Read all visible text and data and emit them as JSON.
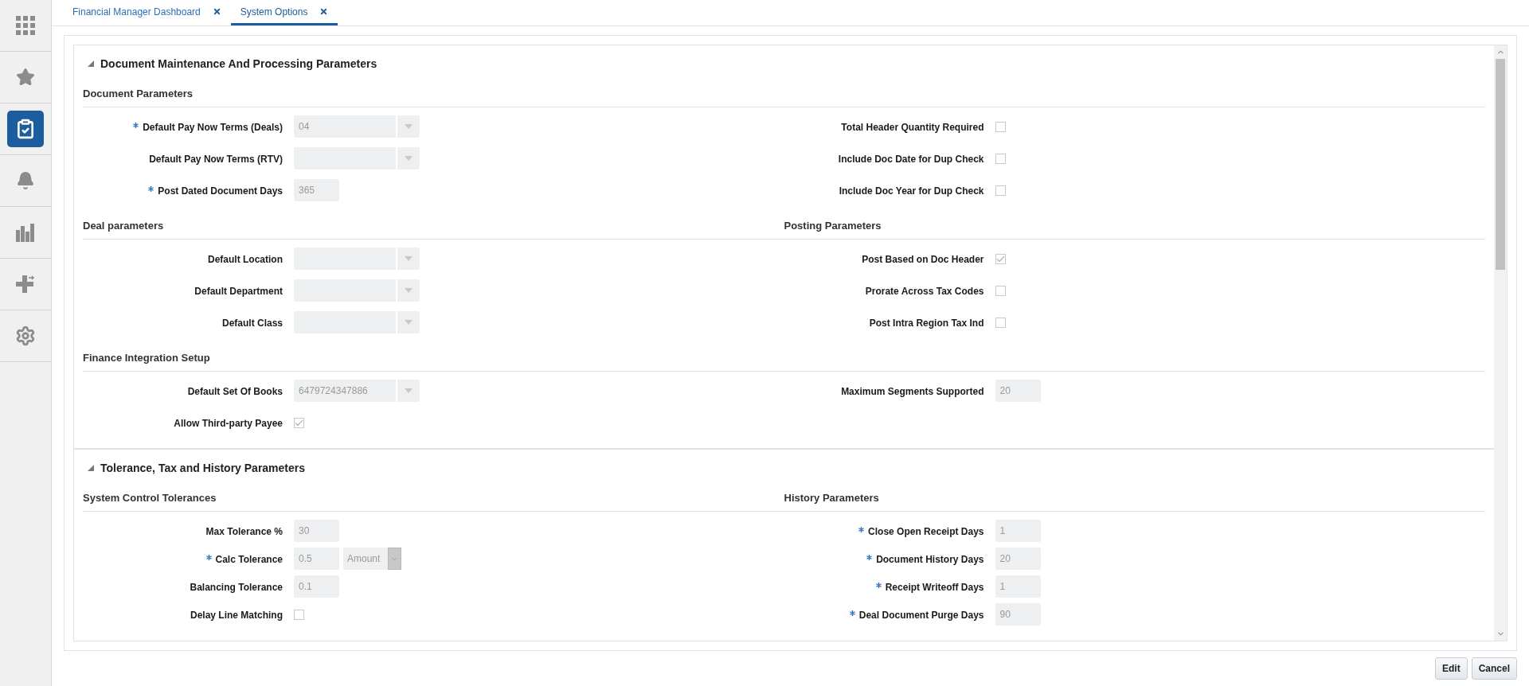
{
  "sidebar": {
    "items": [
      {
        "kind": "apps",
        "selected": false
      },
      {
        "kind": "star",
        "selected": false
      },
      {
        "kind": "tasks",
        "selected": true
      },
      {
        "kind": "bell",
        "selected": false
      },
      {
        "kind": "chart",
        "selected": false
      },
      {
        "kind": "plus",
        "selected": false
      },
      {
        "kind": "gear",
        "selected": false
      }
    ]
  },
  "tabs": [
    {
      "label": "Financial Manager Dashboard",
      "selected": false
    },
    {
      "label": "System Options",
      "selected": true
    }
  ],
  "sections": [
    {
      "title": "Document Maintenance And Processing Parameters",
      "expanded": true,
      "blocks": [
        {
          "left": {
            "heading": "Document Parameters",
            "fields": [
              {
                "kind": "select",
                "label": "Default Pay Now Terms (Deals)",
                "required": true,
                "value": "04"
              },
              {
                "kind": "select",
                "label": "Default Pay Now Terms (RTV)",
                "required": false
              },
              {
                "kind": "text",
                "label": "Post Dated Document Days",
                "required": true,
                "value": "365"
              }
            ]
          },
          "right": {
            "fields": [
              {
                "kind": "checkbox",
                "label": "Total Header Quantity Required",
                "required": false,
                "checked": false
              },
              {
                "kind": "checkbox",
                "label": "Include Doc Date for Dup Check",
                "required": false,
                "checked": false
              },
              {
                "kind": "checkbox",
                "label": "Include Doc Year for Dup Check",
                "required": false,
                "checked": false
              }
            ]
          }
        },
        {
          "left": {
            "heading": "Deal parameters",
            "fields": [
              {
                "kind": "select",
                "label": "Default Location",
                "required": false
              },
              {
                "kind": "select",
                "label": "Default Department",
                "required": false
              },
              {
                "kind": "select",
                "label": "Default Class",
                "required": false
              }
            ]
          },
          "right": {
            "heading": "Posting Parameters",
            "fields": [
              {
                "kind": "checkbox",
                "label": "Post Based on Doc Header",
                "required": false,
                "checked": true
              },
              {
                "kind": "checkbox",
                "label": "Prorate Across Tax Codes",
                "required": false,
                "checked": false
              },
              {
                "kind": "checkbox",
                "label": "Post Intra Region Tax Ind",
                "required": false,
                "checked": false
              }
            ]
          }
        },
        {
          "left": {
            "heading": "Finance Integration Setup",
            "fields": [
              {
                "kind": "select",
                "label": "Default Set Of Books",
                "required": false,
                "value": "6479724347886"
              },
              {
                "kind": "checkbox",
                "label": "Allow Third-party Payee",
                "required": false,
                "checked": true
              }
            ]
          },
          "right": {
            "fields": [
              {
                "kind": "text",
                "label": "Maximum Segments Supported",
                "required": false,
                "value": "20"
              }
            ]
          }
        }
      ]
    },
    {
      "title": "Tolerance, Tax and History Parameters",
      "expanded": true,
      "blocks": [
        {
          "left": {
            "heading": "System Control Tolerances",
            "fields": [
              {
                "kind": "text",
                "label": "Max Tolerance %",
                "required": false,
                "value": "30"
              },
              {
                "kind": "text_select",
                "label": "Calc Tolerance",
                "required": true,
                "value": "0.5",
                "option": "Amount"
              },
              {
                "kind": "text",
                "label": "Balancing Tolerance",
                "required": false,
                "value": "0.1"
              },
              {
                "kind": "checkbox",
                "label": "Delay Line Matching",
                "required": false,
                "checked": false
              }
            ]
          },
          "right": {
            "heading": "History Parameters",
            "fields": [
              {
                "kind": "text",
                "label": "Close Open Receipt Days",
                "required": true,
                "value": "1"
              },
              {
                "kind": "text",
                "label": "Document History Days",
                "required": true,
                "value": "20"
              },
              {
                "kind": "text",
                "label": "Receipt Writeoff Days",
                "required": true,
                "value": "1"
              },
              {
                "kind": "text",
                "label": "Deal Document Purge Days",
                "required": true,
                "value": "90"
              }
            ]
          }
        }
      ]
    }
  ],
  "buttons": [
    "Edit",
    "Cancel"
  ]
}
